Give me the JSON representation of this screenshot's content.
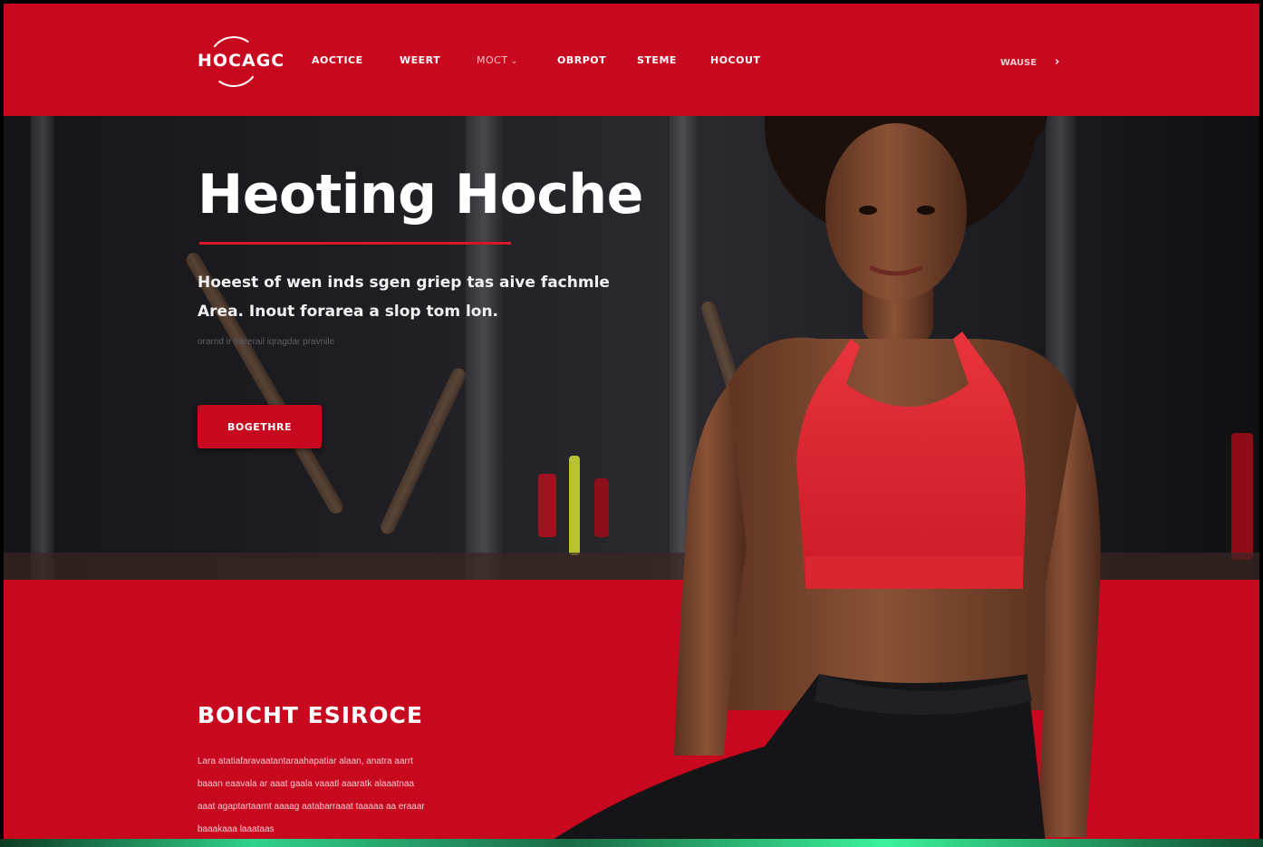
{
  "header": {
    "logo_text": "HOCAGC",
    "nav": [
      {
        "label": "AOCTICE"
      },
      {
        "label": "WEERT"
      },
      {
        "label": "MOCT"
      },
      {
        "label": "OBRPOT"
      },
      {
        "label": "STEME"
      },
      {
        "label": "HOCOUT"
      }
    ],
    "right_link": "WAUSE",
    "right_arrow": "›"
  },
  "hero": {
    "title": "Heoting Hoche",
    "subtitle_line1": "Hoeest of wen inds sgen griep tas aive fachmle",
    "subtitle_line2": "Area. Inout forarea a slop tom lon.",
    "fine_print": "orarnd ir trarerail iqragdar pravnile",
    "cta_label": "BOGETHRE"
  },
  "section": {
    "title": "BOICHT ESIROCE",
    "body_line1": "Lara atatiafaravaatantaraahapatiar alaan, anatra aarrt",
    "body_line2": "baaan eaavala ar aaat gaala vaaatl aaaratk alaaatnaa",
    "body_line3": "aaat agaptartaarnt aaaag aatabarraaat taaaaa aa eraaar",
    "body_line4": "baaakaaa laaataas"
  },
  "colors": {
    "brand_red": "#c8081f",
    "hero_dark": "#1f1f23",
    "accent_line": "#d9172b"
  }
}
